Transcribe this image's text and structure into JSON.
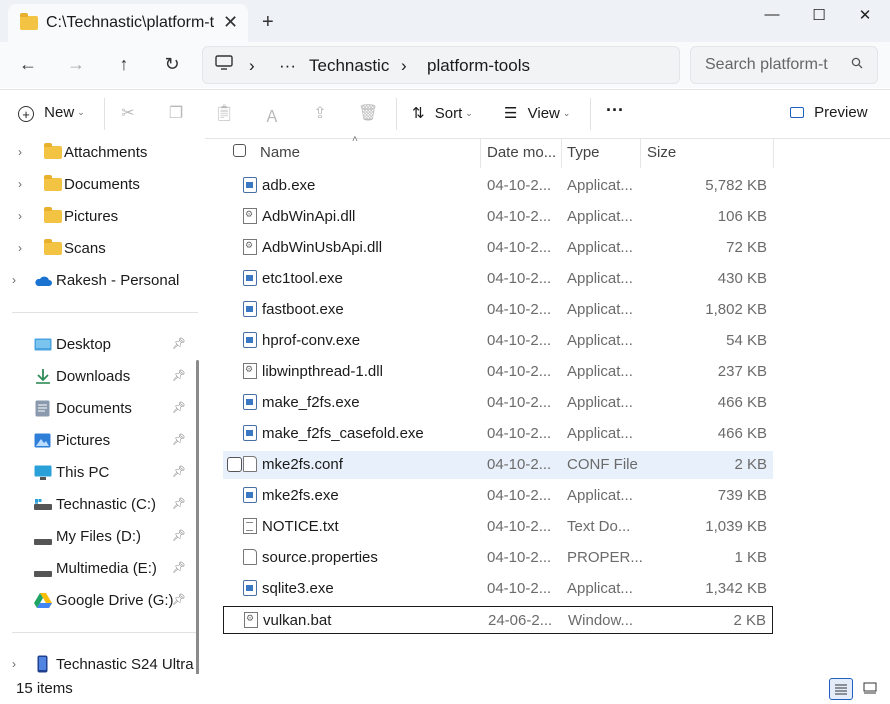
{
  "window": {
    "tab_title": "C:\\Technastic\\platform-t",
    "tab_close": "✕",
    "new_tab": "+",
    "minimize": "—",
    "maximize": "☐",
    "close": "✕"
  },
  "nav": {
    "back": "←",
    "forward": "→",
    "up": "↑",
    "refresh": "↻",
    "breadcrumb": [
      "Technastic",
      "platform-tools"
    ],
    "more": "···",
    "sep": "›",
    "search_placeholder": "Search platform-t"
  },
  "toolbar": {
    "new_label": "New",
    "sort_label": "Sort",
    "view_label": "View",
    "more_label": "···",
    "preview_label": "Preview"
  },
  "sidebar": {
    "tree": [
      {
        "label": "Attachments",
        "icon": "folder-icon"
      },
      {
        "label": "Documents",
        "icon": "folder-icon"
      },
      {
        "label": "Pictures",
        "icon": "folder-icon"
      },
      {
        "label": "Scans",
        "icon": "folder-icon"
      },
      {
        "label": "Rakesh - Personal",
        "icon": "onedrive-icon"
      }
    ],
    "quick": [
      {
        "label": "Desktop",
        "icon": "desktop-icon"
      },
      {
        "label": "Downloads",
        "icon": "download-icon"
      },
      {
        "label": "Documents",
        "icon": "documents-icon"
      },
      {
        "label": "Pictures",
        "icon": "pictures-icon"
      },
      {
        "label": "This PC",
        "icon": "pc-icon"
      },
      {
        "label": "Technastic (C:)",
        "icon": "drive-icon"
      },
      {
        "label": "My Files (D:)",
        "icon": "drive-icon"
      },
      {
        "label": "Multimedia (E:)",
        "icon": "drive-icon"
      },
      {
        "label": "Google Drive (G:)",
        "icon": "google-drive-icon"
      }
    ],
    "device": {
      "label": "Technastic S24 Ultra",
      "icon": "phone-icon"
    }
  },
  "columns": {
    "name": "Name",
    "date": "Date mo...",
    "type": "Type",
    "size": "Size"
  },
  "files": [
    {
      "name": "adb.exe",
      "date": "04-10-2...",
      "type": "Applicat...",
      "size": "5,782 KB",
      "kind": "exe"
    },
    {
      "name": "AdbWinApi.dll",
      "date": "04-10-2...",
      "type": "Applicat...",
      "size": "106 KB",
      "kind": "gear"
    },
    {
      "name": "AdbWinUsbApi.dll",
      "date": "04-10-2...",
      "type": "Applicat...",
      "size": "72 KB",
      "kind": "gear"
    },
    {
      "name": "etc1tool.exe",
      "date": "04-10-2...",
      "type": "Applicat...",
      "size": "430 KB",
      "kind": "exe"
    },
    {
      "name": "fastboot.exe",
      "date": "04-10-2...",
      "type": "Applicat...",
      "size": "1,802 KB",
      "kind": "exe"
    },
    {
      "name": "hprof-conv.exe",
      "date": "04-10-2...",
      "type": "Applicat...",
      "size": "54 KB",
      "kind": "exe"
    },
    {
      "name": "libwinpthread-1.dll",
      "date": "04-10-2...",
      "type": "Applicat...",
      "size": "237 KB",
      "kind": "gear"
    },
    {
      "name": "make_f2fs.exe",
      "date": "04-10-2...",
      "type": "Applicat...",
      "size": "466 KB",
      "kind": "exe"
    },
    {
      "name": "make_f2fs_casefold.exe",
      "date": "04-10-2...",
      "type": "Applicat...",
      "size": "466 KB",
      "kind": "exe"
    },
    {
      "name": "mke2fs.conf",
      "date": "04-10-2...",
      "type": "CONF File",
      "size": "2 KB",
      "kind": "doc"
    },
    {
      "name": "mke2fs.exe",
      "date": "04-10-2...",
      "type": "Applicat...",
      "size": "739 KB",
      "kind": "exe"
    },
    {
      "name": "NOTICE.txt",
      "date": "04-10-2...",
      "type": "Text Do...",
      "size": "1,039 KB",
      "kind": "txt"
    },
    {
      "name": "source.properties",
      "date": "04-10-2...",
      "type": "PROPER...",
      "size": "1 KB",
      "kind": "doc"
    },
    {
      "name": "sqlite3.exe",
      "date": "04-10-2...",
      "type": "Applicat...",
      "size": "1,342 KB",
      "kind": "exe"
    },
    {
      "name": "vulkan.bat",
      "date": "24-06-2...",
      "type": "Window...",
      "size": "2 KB",
      "kind": "gear"
    }
  ],
  "hovered_file": "mke2fs.conf",
  "focused_file": "vulkan.bat",
  "status": {
    "item_count": "15 items"
  },
  "colors": {
    "accent": "#1f5fbf",
    "folder": "#f3c343",
    "selection": "#e8f0fb"
  }
}
